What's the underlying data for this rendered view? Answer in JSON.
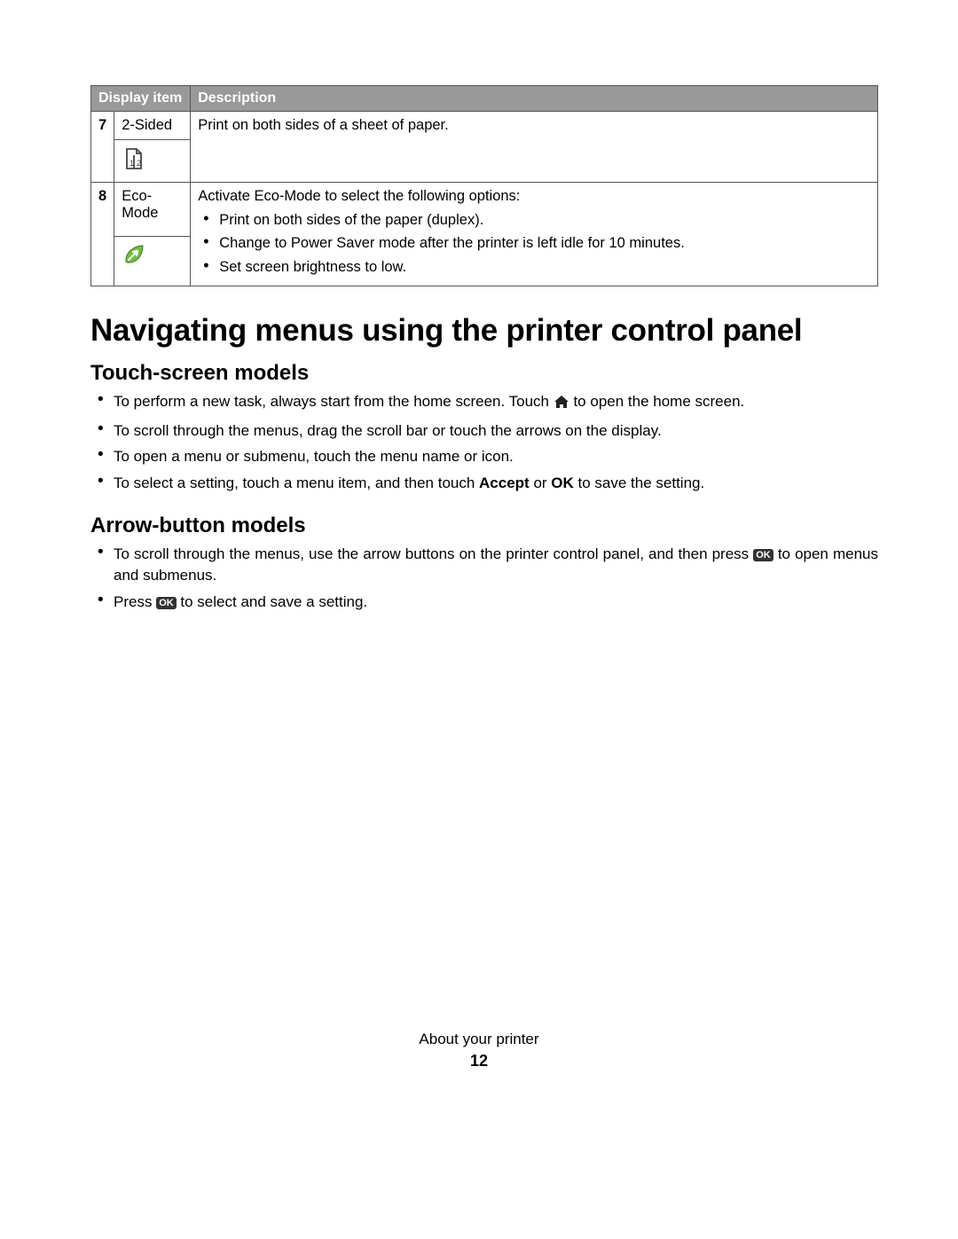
{
  "table": {
    "headers": {
      "item": "Display item",
      "desc": "Description"
    },
    "rows": [
      {
        "num": "7",
        "item": "2-Sided",
        "desc_plain": "Print on both sides of a sheet of paper."
      },
      {
        "num": "8",
        "item": "Eco-Mode",
        "desc_intro": "Activate Eco-Mode to select the following options:",
        "desc_bullets": [
          "Print on both sides of the paper (duplex).",
          "Change to Power Saver mode after the printer is left idle for 10 minutes.",
          "Set screen brightness to low."
        ]
      }
    ]
  },
  "section_heading": "Navigating menus using the printer control panel",
  "touch": {
    "heading": "Touch-screen models",
    "b1a": "To perform a new task, always start from the home screen. Touch ",
    "b1b": " to open the home screen.",
    "b2": "To scroll through the menus, drag the scroll bar or touch the arrows on the display.",
    "b3": "To open a menu or submenu, touch the menu name or icon.",
    "b4a": "To select a setting, touch a menu item, and then touch ",
    "b4_accept": "Accept",
    "b4_or": " or ",
    "b4_ok": "OK",
    "b4b": " to save the setting."
  },
  "arrow": {
    "heading": "Arrow-button models",
    "b1a": "To scroll through the menus, use the arrow buttons on the printer control panel, and then press ",
    "b1b": " to open menus and submenus.",
    "b2a": "Press ",
    "b2b": " to select and save a setting.",
    "ok_label": "OK"
  },
  "footer": {
    "chapter": "About your printer",
    "page": "12"
  }
}
